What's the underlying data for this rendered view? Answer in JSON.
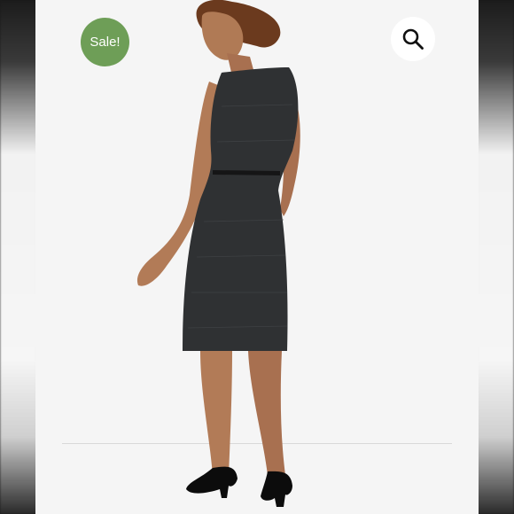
{
  "badge": {
    "label": "Sale!",
    "color": "#6e9e57"
  },
  "zoom": {
    "icon": "search-icon"
  },
  "photo": {
    "background": "#f5f5f5",
    "dress_color": "#2f3133"
  }
}
